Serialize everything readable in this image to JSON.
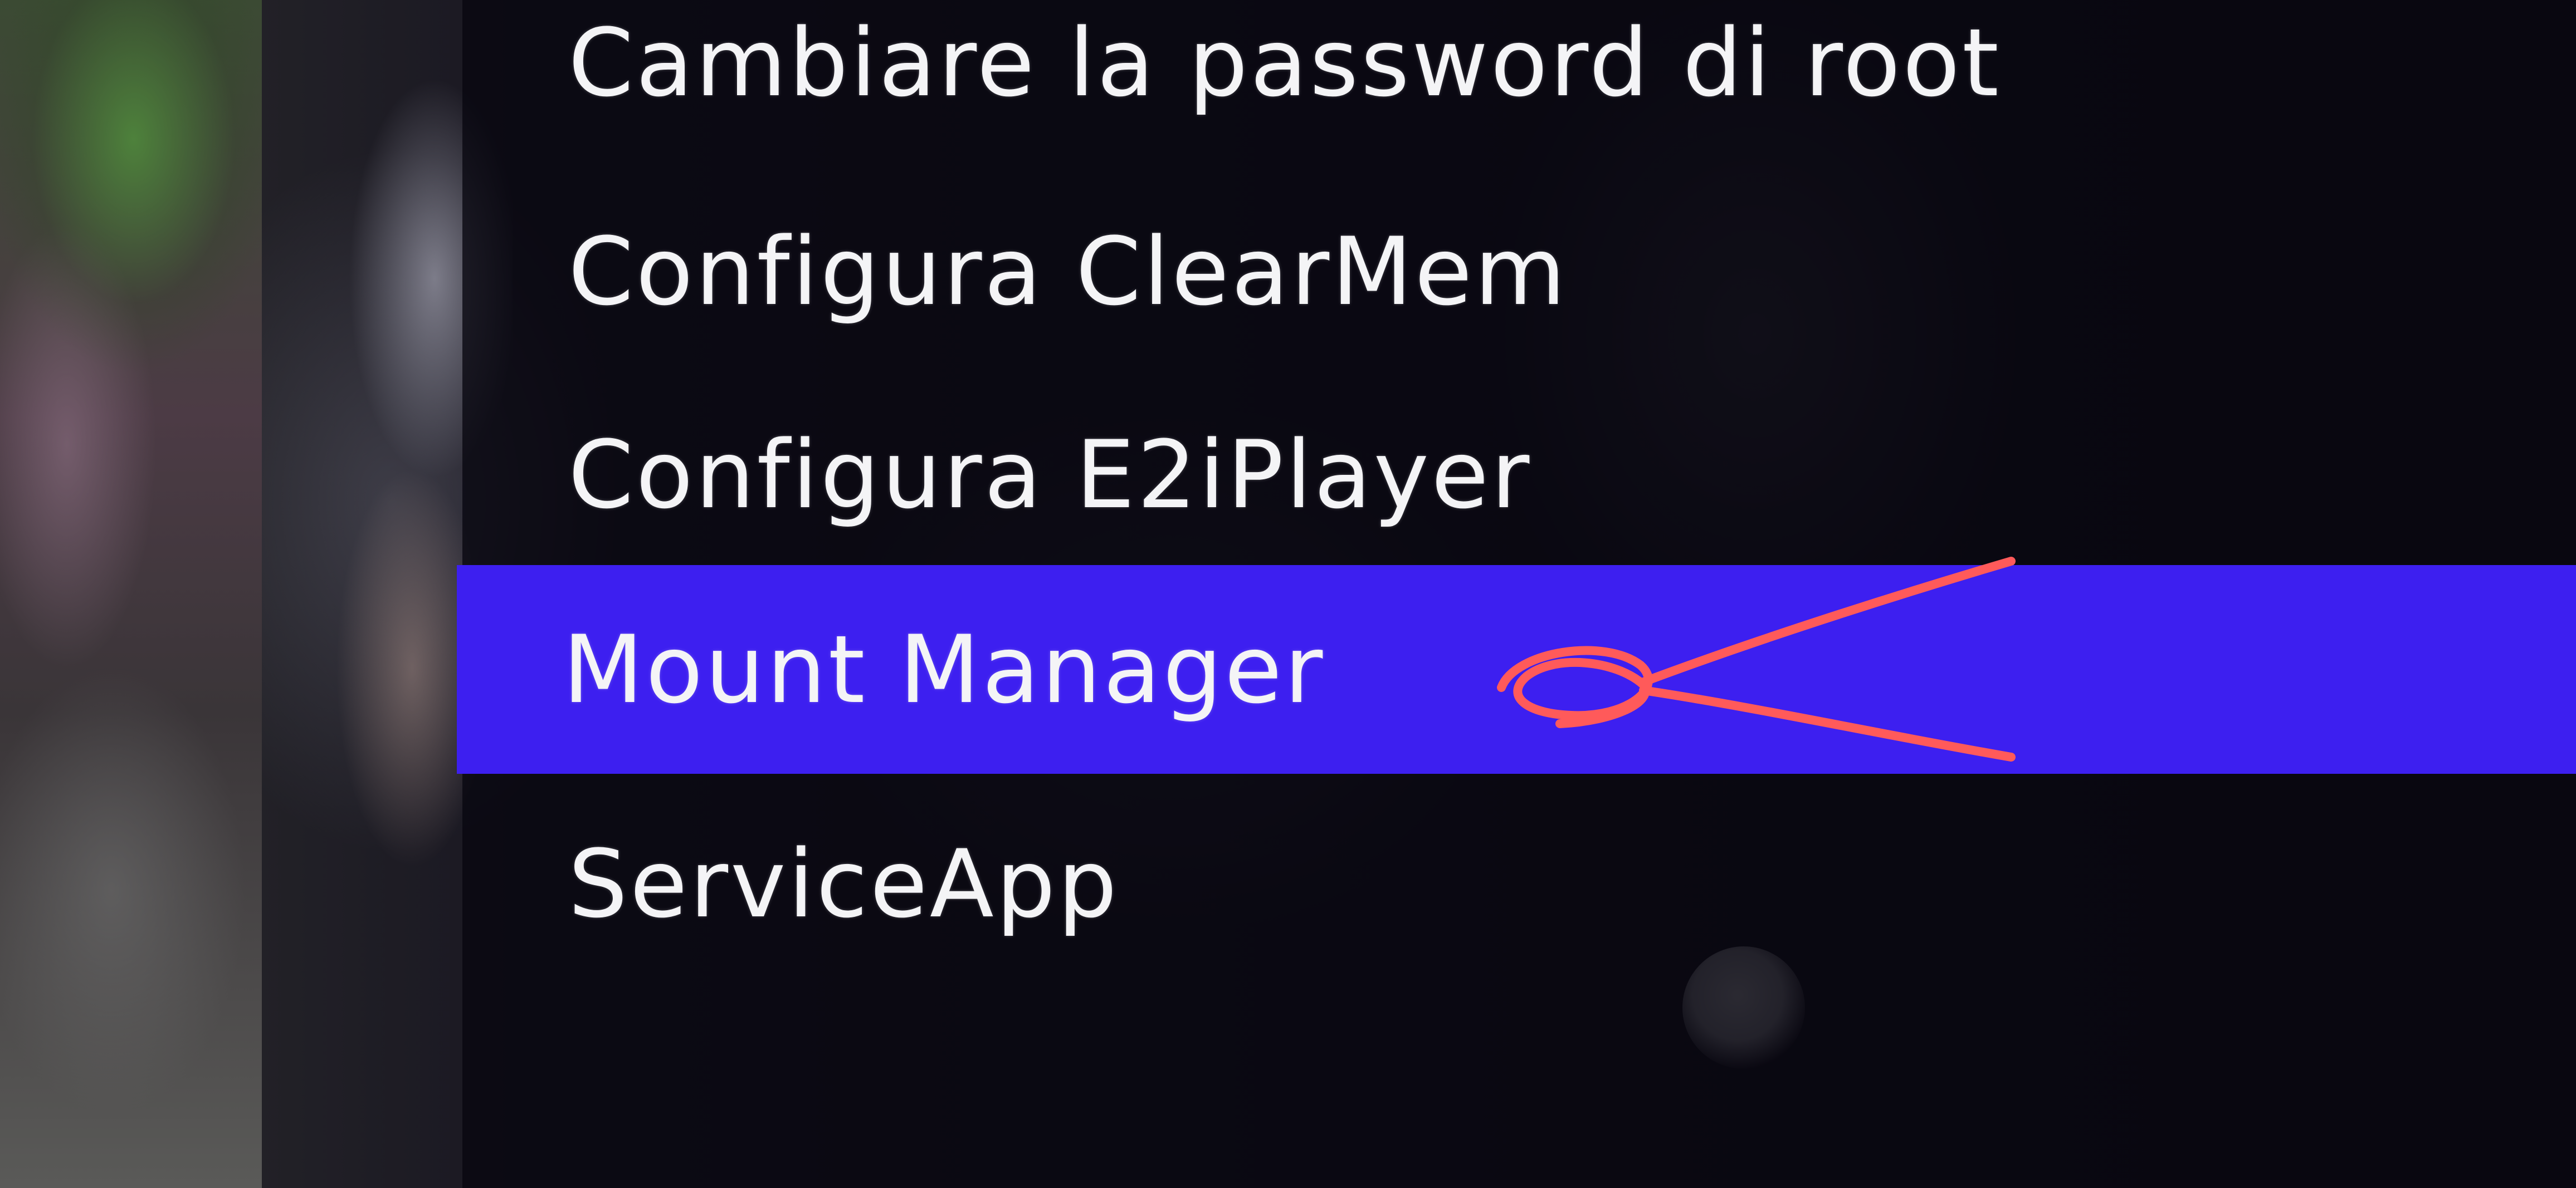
{
  "menu": {
    "items": [
      {
        "label": "Cambiare la password di root",
        "selected": false
      },
      {
        "label": "Configura ClearMem",
        "selected": false
      },
      {
        "label": "Configura E2iPlayer",
        "selected": false
      },
      {
        "label": "Mount Manager",
        "selected": true
      },
      {
        "label": "ServiceApp",
        "selected": false
      }
    ],
    "highlight_color": "#3d1ff0",
    "text_color": "#f4f4f6"
  },
  "annotation": {
    "type": "hand-drawn-arrow",
    "color": "#ff5a5a",
    "points_to": "Mount Manager"
  }
}
